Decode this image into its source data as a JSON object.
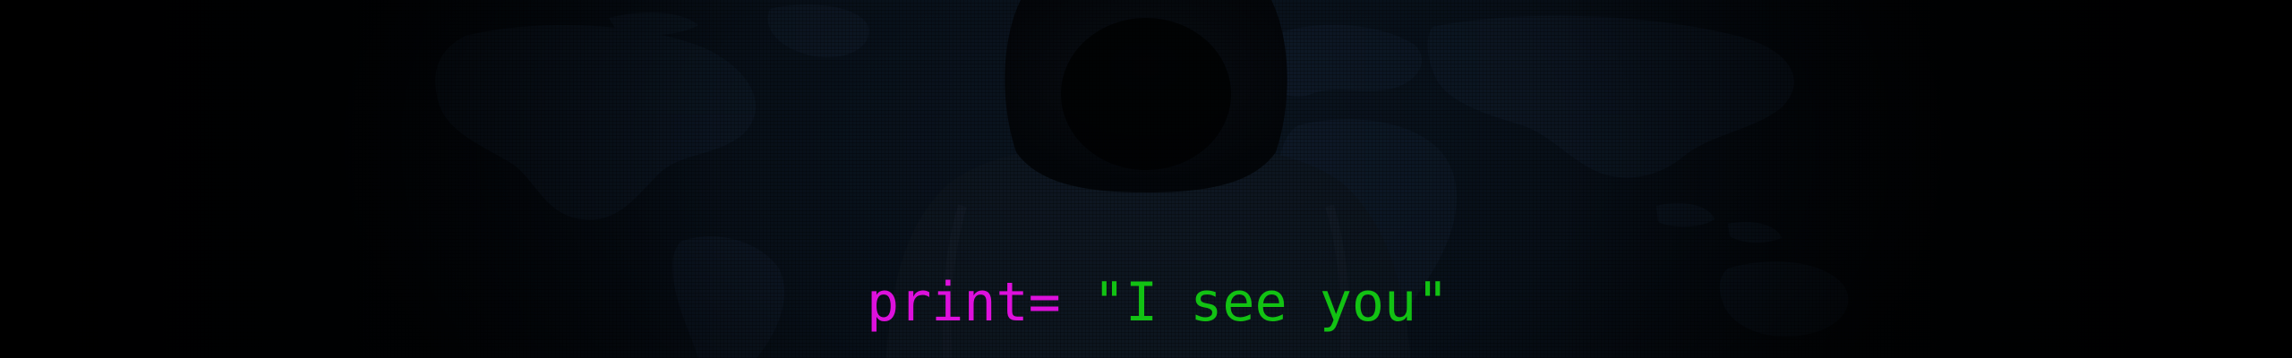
{
  "banner": {
    "code": {
      "keyword": "print=",
      "spacer": " ",
      "string": "\"I see you\""
    }
  },
  "colors": {
    "keyword": "#dd10dc",
    "string": "#12c213",
    "background": "#0a1420"
  },
  "illustration": {
    "subject": "hooded-figure-icon",
    "backdrop": "world-map-icon"
  }
}
